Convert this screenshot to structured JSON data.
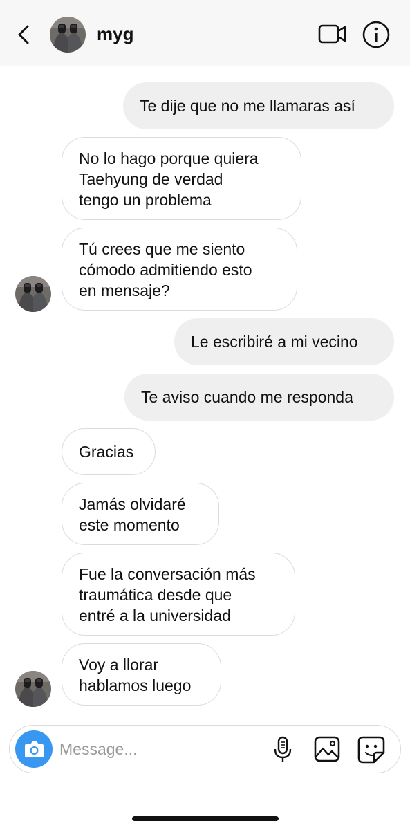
{
  "header": {
    "contact_name": "myg",
    "icons": {
      "back": "chevron-left-icon",
      "video": "video-camera-icon",
      "info": "info-icon"
    }
  },
  "messages": [
    {
      "side": "sent",
      "text": "Te dije que no me llamaras así"
    },
    {
      "side": "received",
      "text": "No lo hago porque quiera\nTaehyung de verdad\ntengo un problema"
    },
    {
      "side": "received",
      "text": "Tú crees que me siento\ncómodo admitiendo esto\nen mensaje?"
    },
    {
      "side": "sent",
      "text": "Le escribiré a mi vecino"
    },
    {
      "side": "sent",
      "text": "Te aviso cuando me responda"
    },
    {
      "side": "received",
      "text": "Gracias"
    },
    {
      "side": "received",
      "text": "Jamás olvidaré\neste momento"
    },
    {
      "side": "received",
      "text": "Fue la conversación más\ntraumática desde que\nentré a la universidad"
    },
    {
      "side": "received",
      "text": "Voy a llorar\nhablamos luego"
    }
  ],
  "composer": {
    "placeholder": "Message...",
    "value": "",
    "icons": {
      "camera": "camera-icon",
      "mic": "microphone-icon",
      "gallery": "image-icon",
      "sticker": "sticker-icon"
    }
  },
  "colors": {
    "accent": "#3897f0",
    "sent_bubble": "#efefef",
    "received_border": "#dbdbdb"
  }
}
